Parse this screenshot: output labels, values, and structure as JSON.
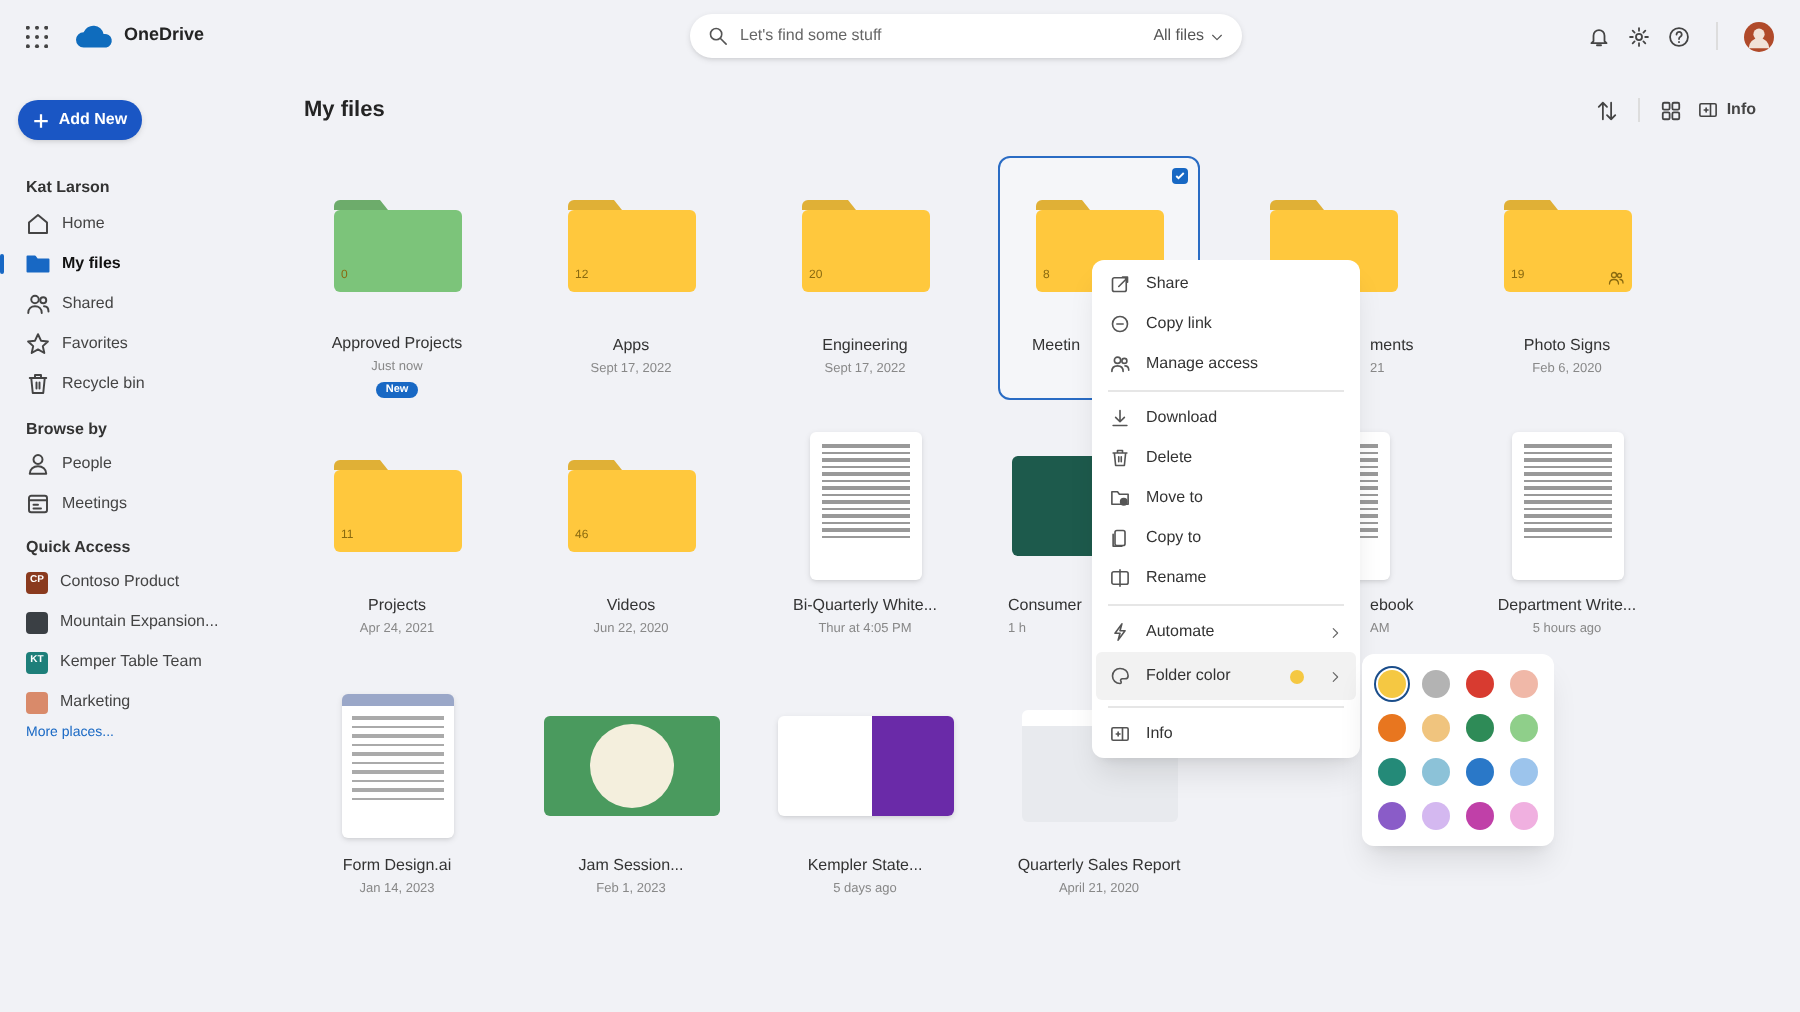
{
  "app": {
    "name": "OneDrive"
  },
  "search": {
    "placeholder": "Let's find some stuff",
    "scope": "All files"
  },
  "add_button": {
    "label": "Add New"
  },
  "sidebar": {
    "user": "Kat Larson",
    "items": [
      {
        "label": "Home",
        "selected": false
      },
      {
        "label": "My files",
        "selected": true
      },
      {
        "label": "Shared",
        "selected": false
      },
      {
        "label": "Favorites",
        "selected": false
      },
      {
        "label": "Recycle bin",
        "selected": false
      }
    ],
    "browse_title": "Browse by",
    "browse": [
      {
        "label": "People"
      },
      {
        "label": "Meetings"
      }
    ],
    "quick_title": "Quick Access",
    "quick": [
      {
        "label": "Contoso Product",
        "kind": "initials",
        "initials": "CP",
        "color": "#8a3a1e"
      },
      {
        "label": "Mountain Expansion...",
        "kind": "image",
        "color": "#3a3f44"
      },
      {
        "label": "Kemper Table Team",
        "kind": "initials",
        "initials": "KT",
        "color": "#1e7f7a"
      },
      {
        "label": "Marketing",
        "kind": "image",
        "color": "#d98a6a"
      }
    ],
    "more": "More places..."
  },
  "heading": "My files",
  "toolbar": {
    "info": "Info"
  },
  "files": [
    {
      "kind": "folder",
      "name": "Approved Projects",
      "date": "Just now",
      "badge": "New",
      "count": "0",
      "color": "#7cc47a",
      "selected": false,
      "shared": false
    },
    {
      "kind": "folder",
      "name": "Apps",
      "date": "Sept 17, 2022",
      "count": "12",
      "color": "#ffc83d",
      "selected": false,
      "shared": false
    },
    {
      "kind": "folder",
      "name": "Engineering",
      "date": "Sept 17, 2022",
      "count": "20",
      "color": "#ffc83d",
      "selected": false,
      "shared": false
    },
    {
      "kind": "folder",
      "name": "Meetin",
      "count": "8",
      "color": "#ffc83d",
      "selected": true,
      "shared": false
    },
    {
      "kind": "folder",
      "name": "ments",
      "date": "21",
      "color": "#ffc83d",
      "selected": false,
      "shared": false
    },
    {
      "kind": "folder",
      "name": "Photo Signs",
      "date": "Feb 6, 2020",
      "count": "19",
      "color": "#ffc83d",
      "selected": false,
      "shared": true
    },
    {
      "kind": "folder",
      "name": "Projects",
      "date": "Apr 24, 2021",
      "count": "11",
      "color": "#ffc83d",
      "selected": false,
      "shared": false
    },
    {
      "kind": "folder",
      "name": "Videos",
      "date": "Jun 22, 2020",
      "count": "46",
      "color": "#ffc83d",
      "selected": false,
      "shared": false
    },
    {
      "kind": "page",
      "name": "Bi-Quarterly White...",
      "date": "Thur at 4:05 PM",
      "selected": false
    },
    {
      "kind": "slide",
      "name": "Consumer",
      "date": "1 h",
      "selected": false
    },
    {
      "kind": "page",
      "name": "ebook",
      "date": "AM",
      "selected": false
    },
    {
      "kind": "page",
      "name": "Department Write...",
      "date": "5 hours ago",
      "selected": false
    },
    {
      "kind": "form",
      "name": "Form Design.ai",
      "date": "Jan 14, 2023",
      "selected": false
    },
    {
      "kind": "slide",
      "name": "Jam Session...",
      "date": "Feb 1, 2023",
      "selected": false
    },
    {
      "kind": "slide",
      "name": "Kempler State...",
      "date": "5 days ago",
      "selected": false
    },
    {
      "kind": "sheet",
      "name": "Quarterly Sales Report",
      "date": "April 21, 2020",
      "selected": false
    }
  ],
  "context_menu": {
    "groups": [
      [
        {
          "label": "Share"
        },
        {
          "label": "Copy link"
        },
        {
          "label": "Manage access"
        }
      ],
      [
        {
          "label": "Download"
        },
        {
          "label": "Delete"
        },
        {
          "label": "Move to"
        },
        {
          "label": "Copy to"
        },
        {
          "label": "Rename"
        }
      ],
      [
        {
          "label": "Automate",
          "submenu": true,
          "highlighted": false
        },
        {
          "label": "Folder color",
          "submenu": true,
          "highlighted": true,
          "color": "#f5c842"
        }
      ],
      [
        {
          "label": "Info"
        }
      ]
    ]
  },
  "color_picker": [
    {
      "color": "#f5c842",
      "selected": true
    },
    {
      "color": "#b3b3b3",
      "selected": false
    },
    {
      "color": "#d83b30",
      "selected": false
    },
    {
      "color": "#f0b8a8",
      "selected": false
    },
    {
      "color": "#e8761f",
      "selected": false
    },
    {
      "color": "#f0c47e",
      "selected": false
    },
    {
      "color": "#2e8b57",
      "selected": false
    },
    {
      "color": "#8fcf8a",
      "selected": false
    },
    {
      "color": "#248a78",
      "selected": false
    },
    {
      "color": "#8cc2d8",
      "selected": false
    },
    {
      "color": "#2a78c8",
      "selected": false
    },
    {
      "color": "#9cc4ec",
      "selected": false
    },
    {
      "color": "#8a5cc8",
      "selected": false
    },
    {
      "color": "#d4b8f0",
      "selected": false
    },
    {
      "color": "#c040a8",
      "selected": false
    },
    {
      "color": "#f0b0e0",
      "selected": false
    }
  ]
}
